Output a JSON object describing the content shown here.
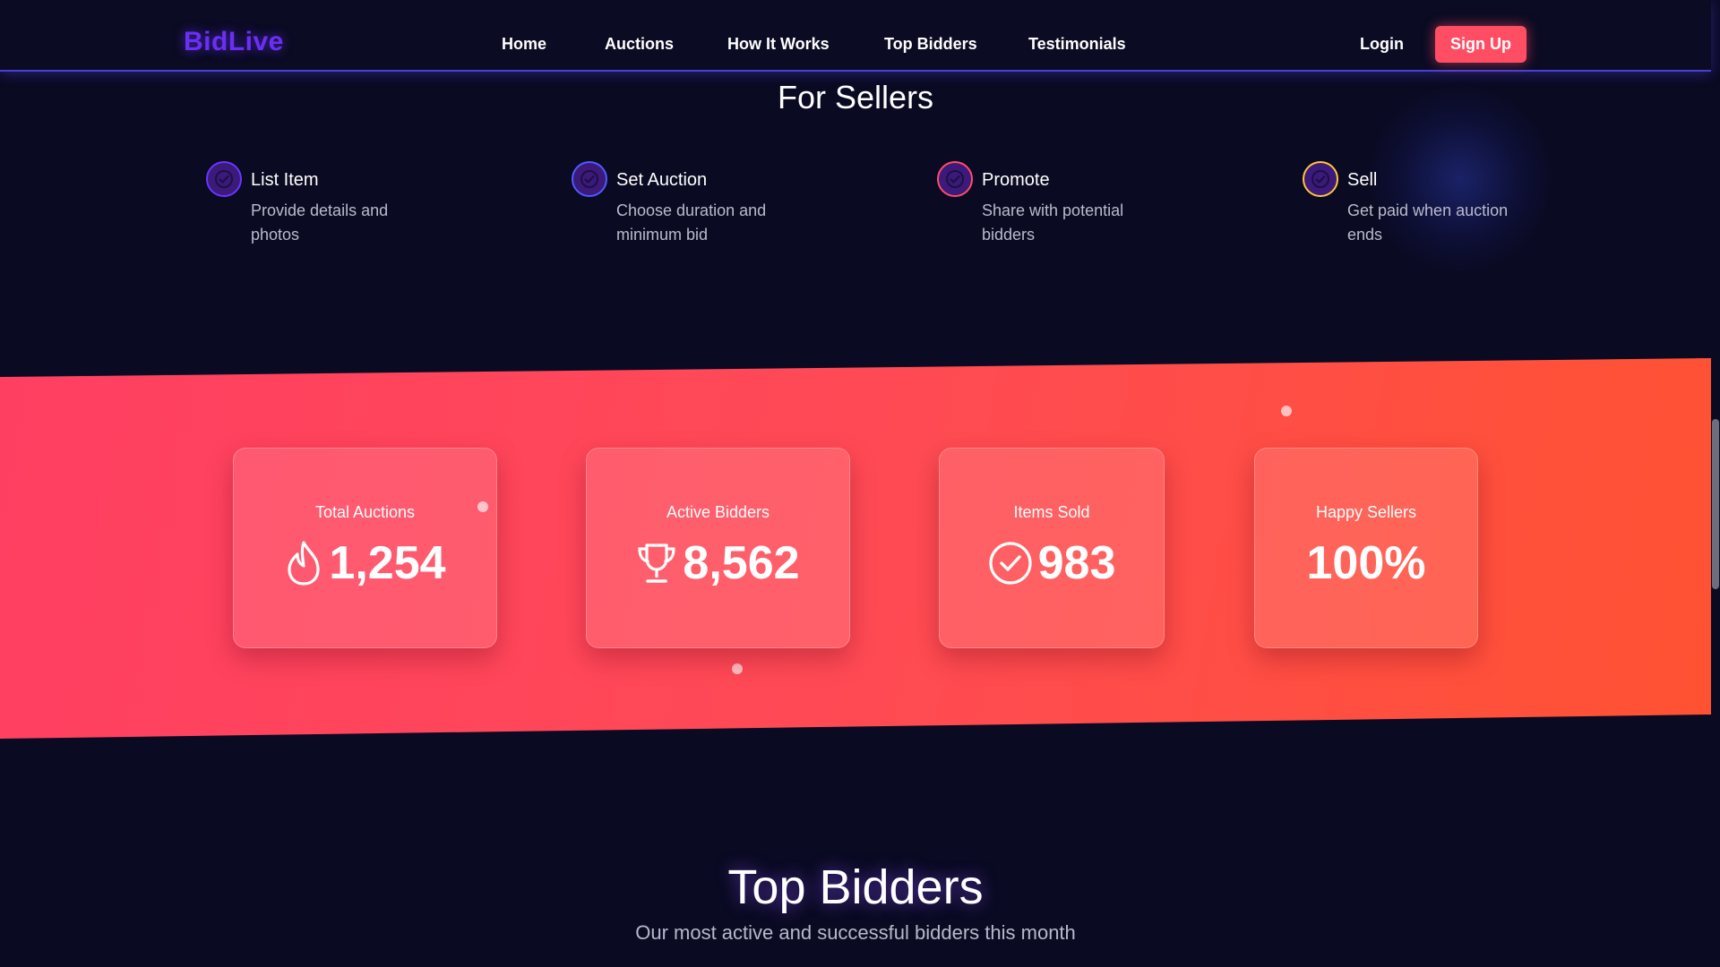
{
  "navbar": {
    "logo": "BidLive",
    "links": [
      "Home",
      "Auctions",
      "How It Works",
      "Top Bidders",
      "Testimonials"
    ],
    "login": "Login",
    "signup": "Sign Up"
  },
  "sellers": {
    "title": "For Sellers",
    "steps": [
      {
        "title": "List Item",
        "desc": "Provide details and photos",
        "icon": "check-circle-icon",
        "accent": "#6a35ff"
      },
      {
        "title": "Set Auction",
        "desc": "Choose duration and minimum bid",
        "icon": "check-circle-icon",
        "accent": "#4f5bff"
      },
      {
        "title": "Promote",
        "desc": "Share with potential bidders",
        "icon": "check-circle-icon",
        "accent": "#ff4d6a"
      },
      {
        "title": "Sell",
        "desc": "Get paid when auction ends",
        "icon": "check-circle-icon",
        "accent": "#ffc53d"
      }
    ]
  },
  "stats": [
    {
      "label": "Total Auctions",
      "value": "1,254",
      "icon": "flame-icon"
    },
    {
      "label": "Active Bidders",
      "value": "8,562",
      "icon": "trophy-icon"
    },
    {
      "label": "Items Sold",
      "value": "983",
      "icon": "check-circle-icon"
    },
    {
      "label": "Happy Sellers",
      "value": "100%",
      "icon": ""
    }
  ],
  "top_bidders": {
    "title": "Top Bidders",
    "subtitle": "Our most active and successful bidders this month"
  },
  "colors": {
    "background": "#0a0a22",
    "logo": "#6a2ff5",
    "signup": "#ff4d64",
    "band_start": "#ff3f62",
    "band_end": "#ff5232"
  }
}
